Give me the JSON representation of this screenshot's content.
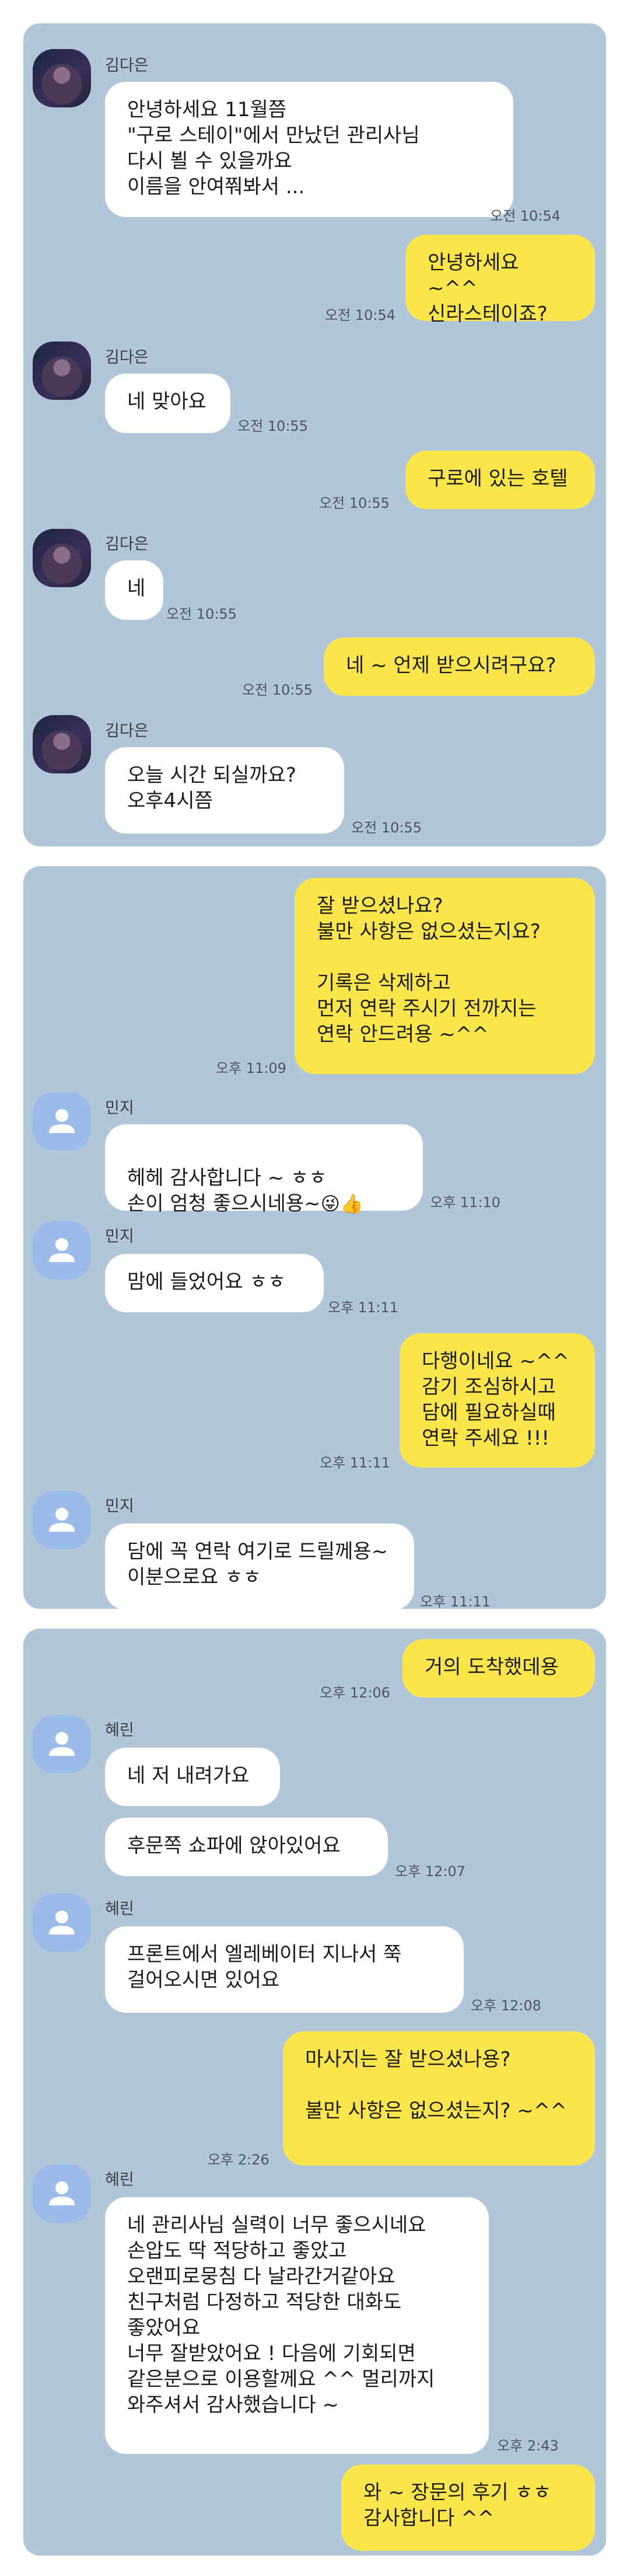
{
  "colors": {
    "panel": "#b2c6da",
    "incoming": "#ffffff",
    "outgoing": "#fbe54d",
    "default_avatar": "#9bbce8"
  },
  "section1": {
    "sender": "김다은",
    "m1": "안녕하세요 11월쯤\n\"구로 스테이\"에서 만났던 관리사님\n다시 뵐 수 있을까요\n이름을 안여쭤봐서 ...",
    "t1": "오전 10:54",
    "m2": "안녕하세요 ~^^\n신라스테이죠?",
    "t2": "오전 10:54",
    "m3": "네 맞아요",
    "t3": "오전 10:55",
    "m4": "구로에 있는 호텔",
    "t4": "오전 10:55",
    "m5": "네",
    "t5": "오전 10:55",
    "m6": "네 ~ 언제 받으시려구요?",
    "t6": "오전 10:55",
    "m7": "오늘 시간 되실까요?\n오후4시쯤",
    "t7": "오전 10:55"
  },
  "section2": {
    "sender": "민지",
    "m1": "잘 받으셨나요?\n불만 사항은 없으셨는지요?\n\n기록은 삭제하고\n먼저 연락 주시기 전까지는\n연락 안드려용 ~^^",
    "t1": "오후 11:09",
    "m2": "헤헤 감사합니다 ~ ㅎㅎ\n손이 엄청 좋으시네용~",
    "emoji": "😜👍",
    "t2": "오후 11:10",
    "m3": "맘에 들었어요 ㅎㅎ",
    "t3": "오후 11:11",
    "m4": "다행이네요 ~^^\n감기 조심하시고\n담에 필요하실때\n연락 주세요 !!!",
    "t4": "오후 11:11",
    "m5": "담에 꼭 연락 여기로 드릴께용~\n이분으로요 ㅎㅎ",
    "t5": "오후 11:11"
  },
  "section3": {
    "sender": "혜린",
    "m1": "거의 도착했데용",
    "t1": "오후 12:06",
    "m2": "네 저 내려가요",
    "m3": "후문쪽 쇼파에 앉아있어요",
    "t3": "오후 12:07",
    "m4": "프론트에서 엘레베이터 지나서 쭉\n걸어오시면 있어요",
    "t4": "오후 12:08",
    "m5": "마사지는 잘 받으셨나용?\n\n불만 사항은 없으셨는지? ~^^",
    "t5": "오후 2:26",
    "m6": "네 관리사님 실력이 너무 좋으시네요\n손압도 딱 적당하고 좋았고\n오랜피로뭉침 다 날라간거같아요\n친구처럼 다정하고 적당한 대화도\n좋았어요\n너무 잘받았어요 ! 다음에 기회되면\n같은분으로 이용할께요 ^^ 멀리까지\n와주셔서 감사했습니다 ~",
    "t6": "오후 2:43",
    "m7": "와 ~ 장문의 후기 ㅎㅎ\n감사합니다 ^^",
    "t7": ""
  }
}
